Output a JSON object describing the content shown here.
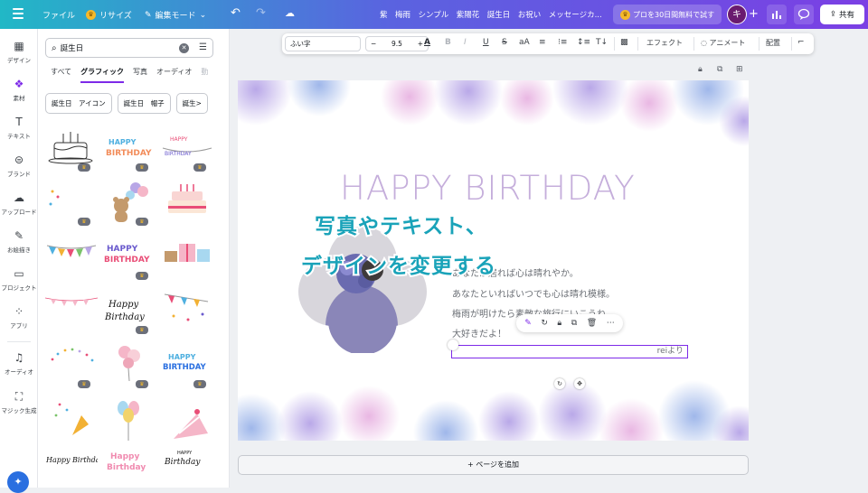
{
  "topbar": {
    "file": "ファイル",
    "resize": "リサイズ",
    "edit_mode": "編集モード",
    "doc_title": "紫　梅雨　シンプル　紫陽花　誕生日　お祝い　メッセージカ...",
    "pro_trial": "プロを30日間無料で試す",
    "avatar_initial": "キ",
    "share": "共有"
  },
  "rail": {
    "design": "デザイン",
    "elements": "素材",
    "text": "テキスト",
    "brand": "ブランド",
    "uploads": "アップロード",
    "draw": "お絵描き",
    "projects": "プロジェクト",
    "apps": "アプリ",
    "audio": "オーディオ",
    "magic": "マジック生成"
  },
  "panel": {
    "search_value": "誕生日",
    "tabs": [
      "すべて",
      "グラフィック",
      "写真",
      "オーディオ",
      "動"
    ],
    "active_tab": "グラフィック",
    "chips": [
      "誕生日　アイコン",
      "誕生日　帽子",
      "誕生>"
    ]
  },
  "toolbar": {
    "font": "ふい字",
    "size": "9.5",
    "effects": "エフェクト",
    "animate": "アニメート",
    "position": "配置"
  },
  "canvas": {
    "headline": "HAPPY BIRTHDAY",
    "lines": [
      "あなたが居れば心は晴れやか。",
      "あなたといればいつでも心は晴れ模様。",
      "梅雨が明けたら素敵な旅行にいこうね。",
      "大好きだよ！"
    ],
    "signature": "reiより",
    "add_page": "+ ページを追加"
  },
  "overlay": {
    "line1": "写真やテキスト、",
    "line2": "デザインを変更する"
  },
  "colors": {
    "accent": "#7d2ae8",
    "overlay_text": "#1aa3b9",
    "headline": "#c5aedb"
  }
}
